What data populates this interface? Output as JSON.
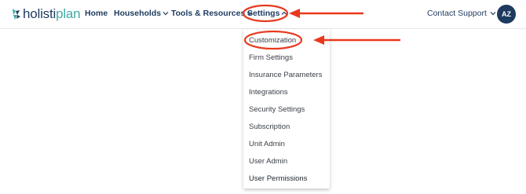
{
  "brand": {
    "name_part_a": "holisti",
    "name_part_b": "plan",
    "primary_color": "#1d3a5f",
    "accent_color": "#3fa9a6"
  },
  "nav": {
    "home": "Home",
    "households": "Households",
    "tools": "Tools & Resources",
    "settings": "Settings",
    "contact_support": "Contact Support",
    "avatar_initials": "AZ"
  },
  "settings_menu": {
    "items": [
      {
        "label": "Customization"
      },
      {
        "label": "Firm Settings"
      },
      {
        "label": "Insurance Parameters"
      },
      {
        "label": "Integrations"
      },
      {
        "label": "Security Settings"
      },
      {
        "label": "Subscription"
      },
      {
        "label": "Unit Admin"
      },
      {
        "label": "User Admin"
      },
      {
        "label": "User Permissions"
      }
    ]
  },
  "annotation": {
    "color": "#e8391e"
  }
}
